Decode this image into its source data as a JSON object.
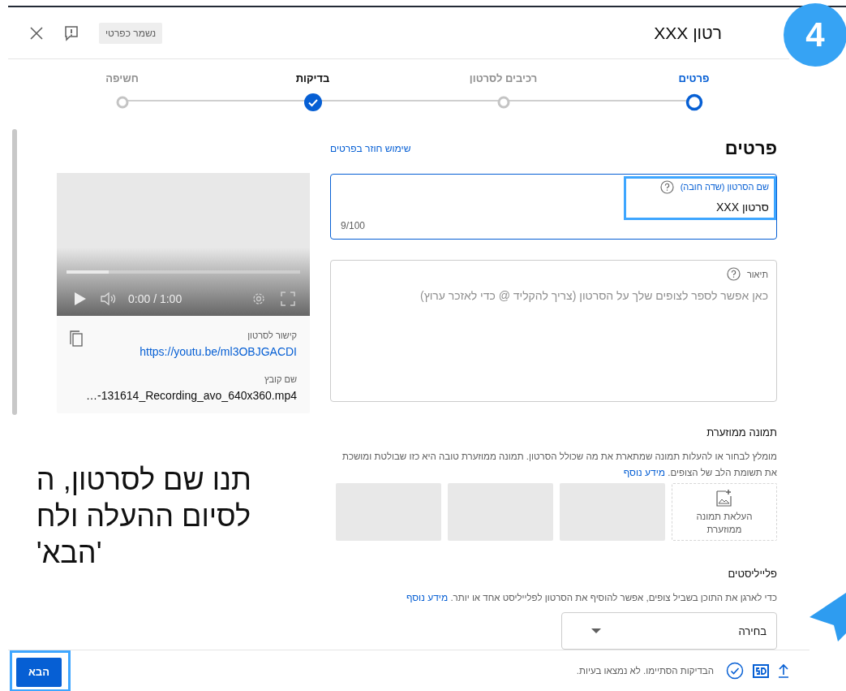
{
  "tutorial": {
    "step_badge": "4",
    "callout_lines": [
      "תנו שם לסרטון, ה",
      "לסיום ההעלה ולח",
      "'הבא'"
    ]
  },
  "dialog": {
    "title": "רטון XXX",
    "save_chip": "נשמר כפרטי"
  },
  "stepper": [
    {
      "label": "פרטים",
      "selected": true,
      "completed": false
    },
    {
      "label": "רכיבים לסרטון",
      "selected": false,
      "completed": false
    },
    {
      "label": "בדיקות",
      "selected": false,
      "completed": true
    },
    {
      "label": "חשיפה",
      "selected": false,
      "completed": false
    }
  ],
  "details": {
    "heading": "פרטים",
    "reuse_link": "שימוש חוזר בפרטים",
    "title_field": {
      "label": "שם הסרטון (שדה חובה)",
      "value": "סרטון XXX",
      "counter": "9/100",
      "highlighted": true
    },
    "description_field": {
      "label": "תיאור",
      "placeholder": "כאן אפשר לספר לצופים שלך על הסרטון (צריך להקליד @ כדי לאזכר ערוץ)"
    }
  },
  "thumbnail": {
    "heading": "תמונה ממוזערת",
    "description": "מומלץ לבחור או להעלות תמונה שמתארת את מה שכולל הסרטון. תמונה ממוזערת טובה היא כזו שבולטת ומושכת את תשומת הלב של הצופים.",
    "link": "מידע נוסף",
    "slots": [
      {
        "kind": "upload",
        "label": "העלאת תמונה ממוזערת"
      },
      {
        "kind": "empty"
      },
      {
        "kind": "empty"
      },
      {
        "kind": "empty"
      }
    ]
  },
  "playlists": {
    "heading": "פלייליסטים",
    "description": "כדי לארגן את התוכן בשביל צופים, אפשר להוסיף את הסרטון לפלייליסט אחד או יותר.",
    "link": "מידע נוסף",
    "dropdown": {
      "value": "בחירה"
    }
  },
  "video": {
    "progress": {
      "level": 0.18
    },
    "time": "0:00 / 1:00",
    "link_label": "קישור לסרטון",
    "link": "https://youtu.be/ml3OBJGACDI",
    "file_label": "שם קובץ",
    "file_name": "…-131614_Recording_avo_640x360.mp4"
  },
  "footer": {
    "status": "הבדיקות הסתיימו. לא נמצאו בעיות.",
    "next_button": "הבא",
    "highlighted": true
  }
}
